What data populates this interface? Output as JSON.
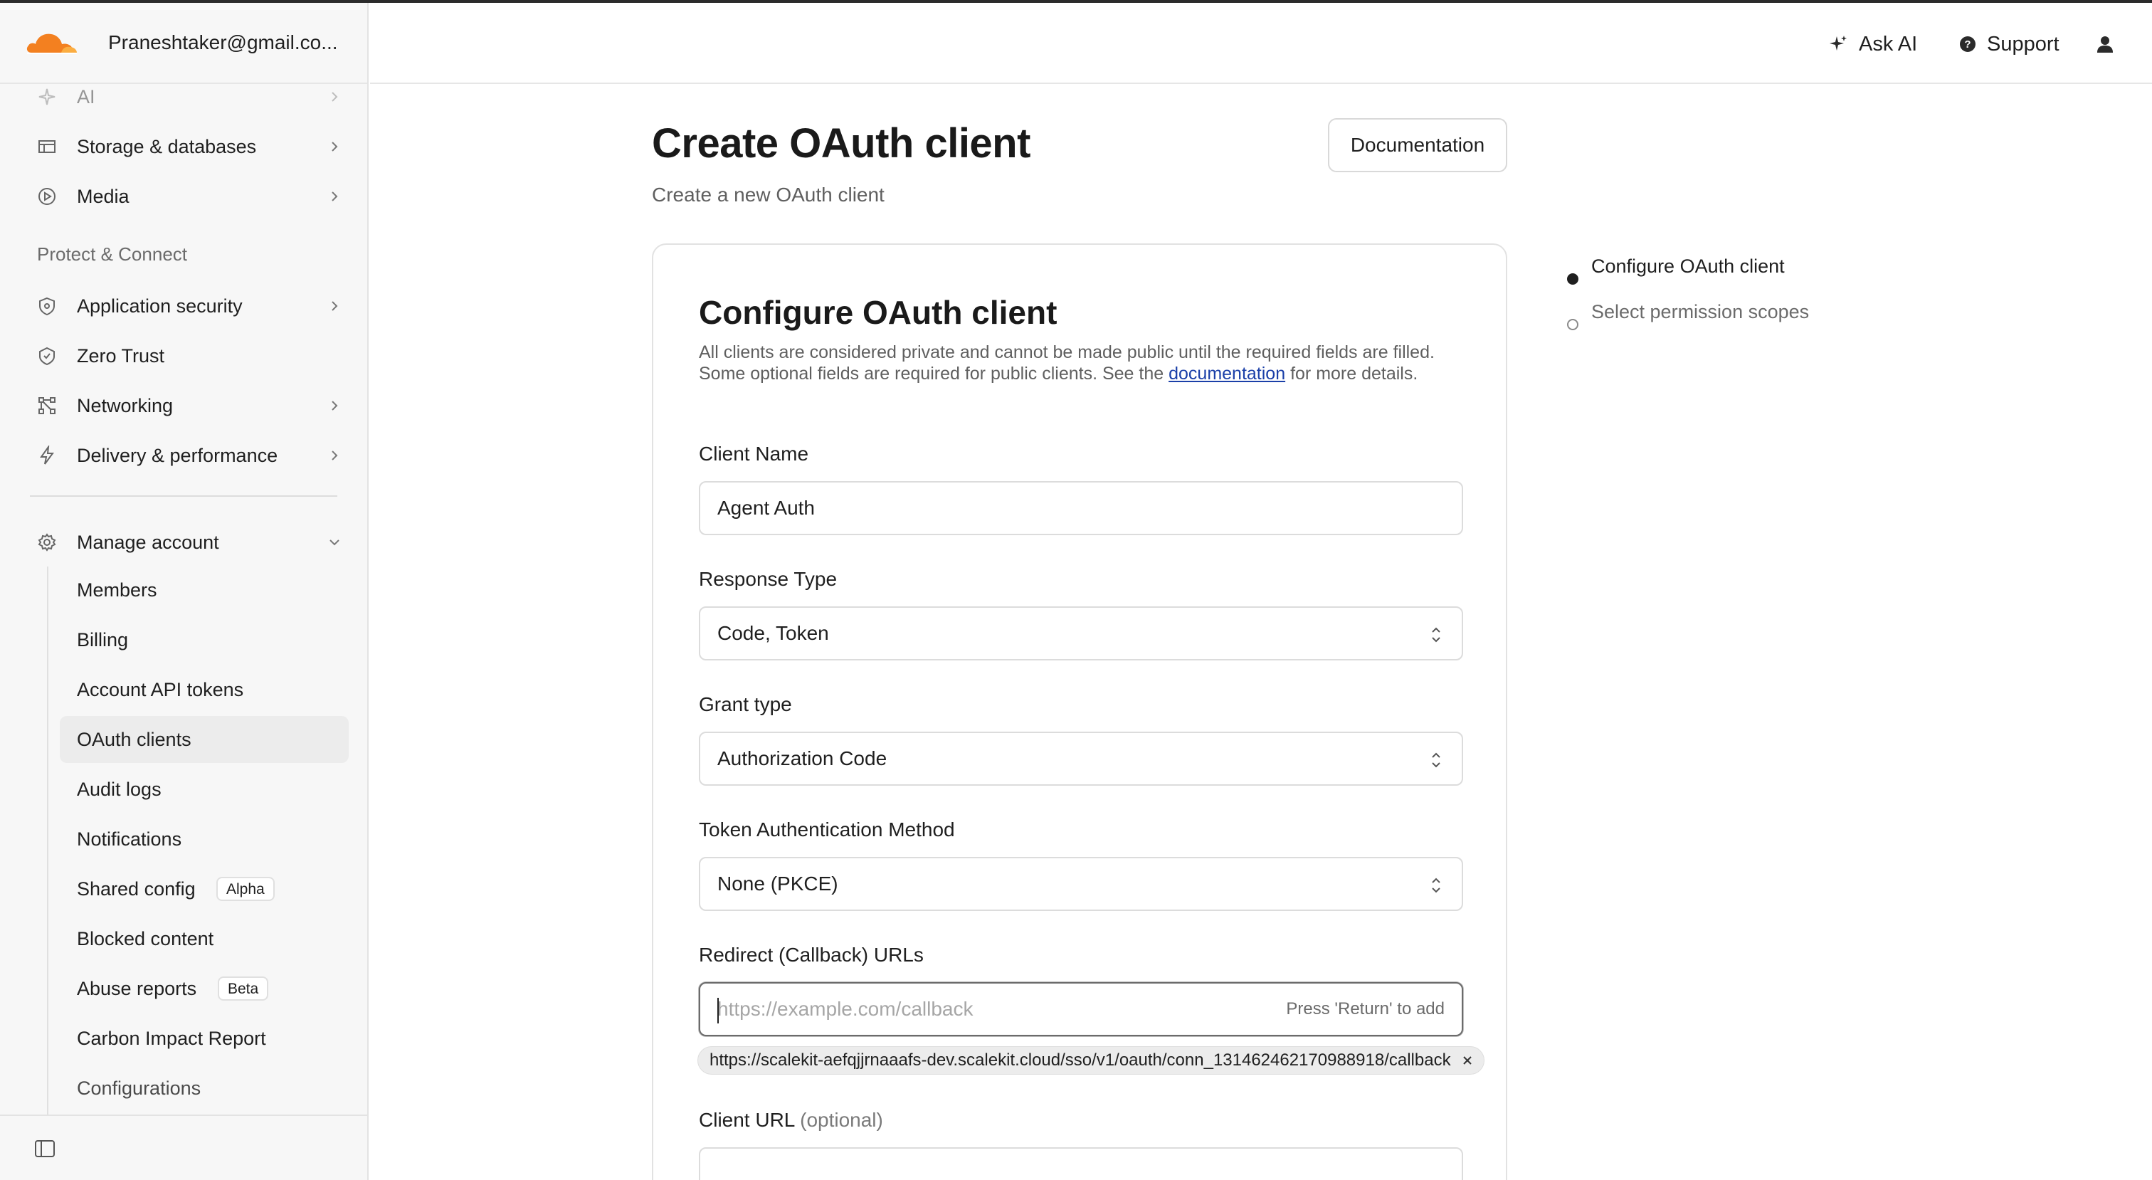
{
  "account": {
    "email": "Praneshtaker@gmail.co..."
  },
  "topbar": {
    "ask_ai": "Ask AI",
    "support": "Support"
  },
  "sidebar": {
    "items": [
      {
        "label": "AI",
        "icon": "sparkle-icon"
      },
      {
        "label": "Storage & databases",
        "icon": "database-icon"
      },
      {
        "label": "Media",
        "icon": "play-icon"
      }
    ],
    "section_label": "Protect & Connect",
    "protect_items": [
      {
        "label": "Application security",
        "icon": "shield-icon"
      },
      {
        "label": "Zero Trust",
        "icon": "zero-trust-icon"
      },
      {
        "label": "Networking",
        "icon": "network-icon"
      },
      {
        "label": "Delivery & performance",
        "icon": "lightning-icon"
      }
    ],
    "manage_account": "Manage account",
    "sub_items": [
      {
        "label": "Members"
      },
      {
        "label": "Billing"
      },
      {
        "label": "Account API tokens"
      },
      {
        "label": "OAuth clients"
      },
      {
        "label": "Audit logs"
      },
      {
        "label": "Notifications"
      },
      {
        "label": "Shared config",
        "badge": "Alpha"
      },
      {
        "label": "Blocked content"
      },
      {
        "label": "Abuse reports",
        "badge": "Beta"
      },
      {
        "label": "Carbon Impact Report"
      },
      {
        "label": "Configurations"
      }
    ]
  },
  "main": {
    "title": "Create OAuth client",
    "subtitle": "Create a new OAuth client",
    "documentation_button": "Documentation",
    "card": {
      "title": "Configure OAuth client",
      "description_before": "All clients are considered private and cannot be made public until the required fields are filled. Some optional fields are required for public clients. See the ",
      "description_link": "documentation",
      "description_after": " for more details.",
      "client_name_label": "Client Name",
      "client_name_value": "Agent Auth",
      "response_type_label": "Response Type",
      "response_type_value": "Code, Token",
      "grant_type_label": "Grant type",
      "grant_type_value": "Authorization Code",
      "token_auth_label": "Token Authentication Method",
      "token_auth_value": "None (PKCE)",
      "redirect_label": "Redirect (Callback) URLs",
      "redirect_placeholder": "https://example.com/callback",
      "redirect_hint": "Press 'Return' to add",
      "redirect_chip": "https://scalekit-aefqjjrnaaafs-dev.scalekit.cloud/sso/v1/oauth/conn_131462462170988918/callback",
      "client_url_label": "Client URL",
      "client_url_optional": "(optional)"
    }
  },
  "stepper": {
    "steps": [
      {
        "label": "Configure OAuth client",
        "active": true
      },
      {
        "label": "Select permission scopes",
        "active": false
      }
    ]
  },
  "colors": {
    "brand_orange": "#f38020",
    "link": "#1a3fa8"
  }
}
